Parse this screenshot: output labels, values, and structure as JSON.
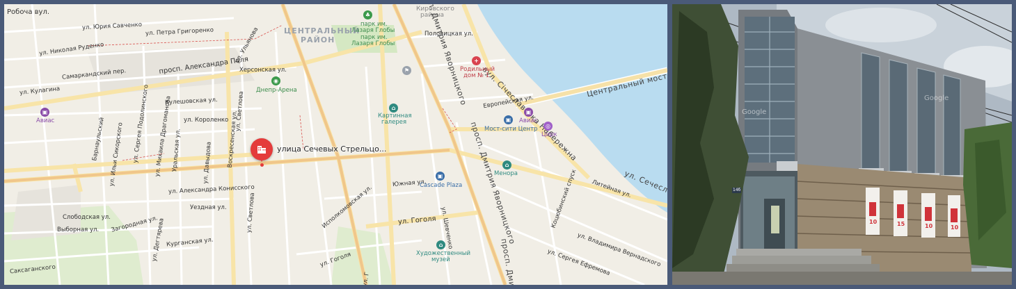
{
  "map": {
    "marker": {
      "label": "улица Сечевых Стрельцо...",
      "icon": "building-icon"
    },
    "district_center": [
      "ЦЕНТРАЛЬНЫЙ",
      "РАЙОН"
    ],
    "district_kirov": [
      "Кировского",
      "района"
    ],
    "streets": {
      "robocha": "Робоча вул.",
      "yuriya_savchenko": "ул. Юрия Савченко",
      "petra_grigorenko": "ул. Петра Григоренко",
      "nikolaya_rudenko": "ул. Николая Руденко",
      "samarkandsky": "Самаркандский пер.",
      "aleksandra_polya": "просп. Александра Поля",
      "khersonskaya": "Херсонская ул.",
      "ulyanova": "ул. Ульянова",
      "kulagina": "ул. Кулагина",
      "kuleshovskaya": "Кулешовская ул.",
      "korolenko": "ул. Короленко",
      "svetlova": "ул. Светлова",
      "barnaulsky": "Барнаульский",
      "sergeya_podolinskogo": "ул. Сергея Подолинского",
      "mikhaila_drahomanova": "ул. Михаила Драгоманова",
      "ilyi_sikorskogo": "ул. Ильи Сикорского",
      "uralskaya": "Уральская ул.",
      "davydova": "ул. Давыдова",
      "voskresenskaya": "Воскресенская ул.",
      "aleksandra_konisskogo": "ул. Александра Конисского",
      "uezdnaya": "Уездная ул.",
      "slobodskaya": "Слободская ул.",
      "vybornaya": "Выборная ул.",
      "zagorodnaya": "Загородная ул.",
      "degtyareva": "ул. Дегтярева",
      "kurganskaya": "Курганская ул.",
      "saksaganskogo": "Саксаганского",
      "svetlova_s": "ул. Светлова",
      "gogolya_w": "ул. Гоголя",
      "ispolkomovskaya": "Исполкомовская ул.",
      "yuzhnaya": "Южная ул.",
      "shevchenko": "ул. Шевченко",
      "gogolya": "ул. Гоголя",
      "dmitriya_yavornitskogo_n": "просп. Дмитрия Яворницкого",
      "dmitriya_yavornitskogo_s": "просп. Дмитрия Яворницкого",
      "dmitriya_yavornitskogo_b": "просп. Дмит",
      "polovitskaya": "Половицкая ул.",
      "sicheslavska_nab": "вул. Січеславська Набережна",
      "tsentralny_most": "Центральный мост",
      "evropeyskaya": "Европейская ул.",
      "kotsyubinsky": "Коцюбинский спуск",
      "liteynaya": "Литейная ул.",
      "sicheslavska_se": "ул. Сечеславська",
      "vladimira_vernadskogo": "ул. Владимира Вернадского",
      "sergeya_efremova": "ул. Сергея Ефремова",
      "upper_small": "ул. Г"
    },
    "pois": [
      {
        "name": "park-globa",
        "lines": [
          "парк им.",
          "Лазаря Глобы",
          "парк им.",
          "Лазаря Глобы"
        ],
        "icon": "tree-icon",
        "color": "#3c9a4c"
      },
      {
        "name": "dnepr-arena",
        "lines": [
          "Днепр-Арена"
        ],
        "icon": "stadium-icon",
        "color": "#3c9a4c"
      },
      {
        "name": "avias-west",
        "lines": [
          "Авиас"
        ],
        "icon": "bag-icon",
        "color": "#8a4ca8"
      },
      {
        "name": "kartinnaya-galereya",
        "lines": [
          "Картинная",
          "галерея"
        ],
        "icon": "museum-icon",
        "color": "#2f8a80"
      },
      {
        "name": "roddom",
        "lines": [
          "Родильный",
          "дом № 1"
        ],
        "icon": "cross-icon",
        "color": "#d9434f"
      },
      {
        "name": "most-city",
        "lines": [
          "Мост-сити Центр"
        ],
        "icon": "bag-icon",
        "color": "#3a6ea8"
      },
      {
        "name": "avias-east",
        "lines": [
          "Авиас"
        ],
        "icon": "bag-icon",
        "color": "#8a4ca8"
      },
      {
        "name": "tsirk",
        "lines": [
          "Цирк"
        ],
        "icon": "circus-icon",
        "color": "#a060c8"
      },
      {
        "name": "menora",
        "lines": [
          "Менора"
        ],
        "icon": "museum-icon",
        "color": "#2f8a80"
      },
      {
        "name": "cascade-plaza",
        "lines": [
          "Cascade Plaza"
        ],
        "icon": "bag-icon",
        "color": "#3a6ea8"
      },
      {
        "name": "khudozh-muzey",
        "lines": [
          "Художественный",
          "музей"
        ],
        "icon": "museum-icon",
        "color": "#2f8a80"
      }
    ]
  },
  "photo": {
    "watermark_left": "Google",
    "watermark_right": "Google",
    "building_number": "14б",
    "posters": [
      "10",
      "15",
      "10",
      "10"
    ]
  }
}
